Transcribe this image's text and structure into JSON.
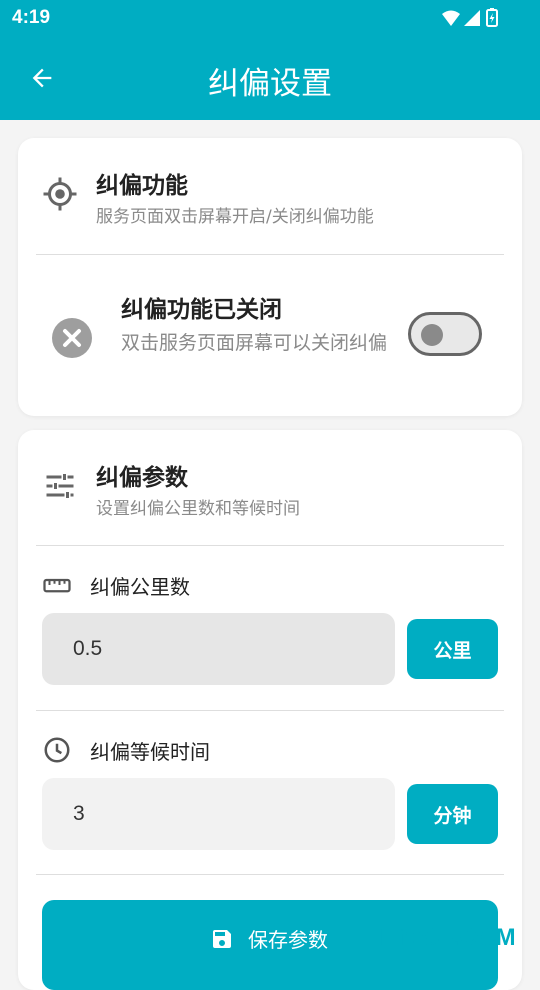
{
  "status_bar": {
    "time": "4:19",
    "icons": [
      "wifi-icon",
      "signal-icon",
      "battery-charging-icon"
    ]
  },
  "app_bar": {
    "title": "纠偏设置",
    "back_icon": "arrow-left-icon"
  },
  "feature_card": {
    "icon": "target-icon",
    "title": "纠偏功能",
    "subtitle": "服务页面双击屏幕开启/关闭纠偏功能",
    "status": {
      "icon": "close-circle-icon",
      "title": "纠偏功能已关闭",
      "description": "双击服务页面屏幕可以关闭纠偏",
      "toggle_on": false
    }
  },
  "params_card": {
    "icon": "sliders-icon",
    "title": "纠偏参数",
    "subtitle": "设置纠偏公里数和等候时间",
    "distance": {
      "icon": "ruler-icon",
      "label": "纠偏公里数",
      "value": "0.5",
      "unit": "公里"
    },
    "wait_time": {
      "icon": "clock-icon",
      "label": "纠偏等候时间",
      "value": "3",
      "unit": "分钟"
    },
    "save_button": {
      "icon": "save-icon",
      "label": "保存参数"
    }
  },
  "watermark": "ITMOP.COM",
  "colors": {
    "primary": "#00adc2",
    "background": "#f4f4f4",
    "card": "#ffffff",
    "muted_text": "#8a8a8a",
    "input_gray": "#e6e6e6",
    "input_light": "#f2f2f2"
  }
}
